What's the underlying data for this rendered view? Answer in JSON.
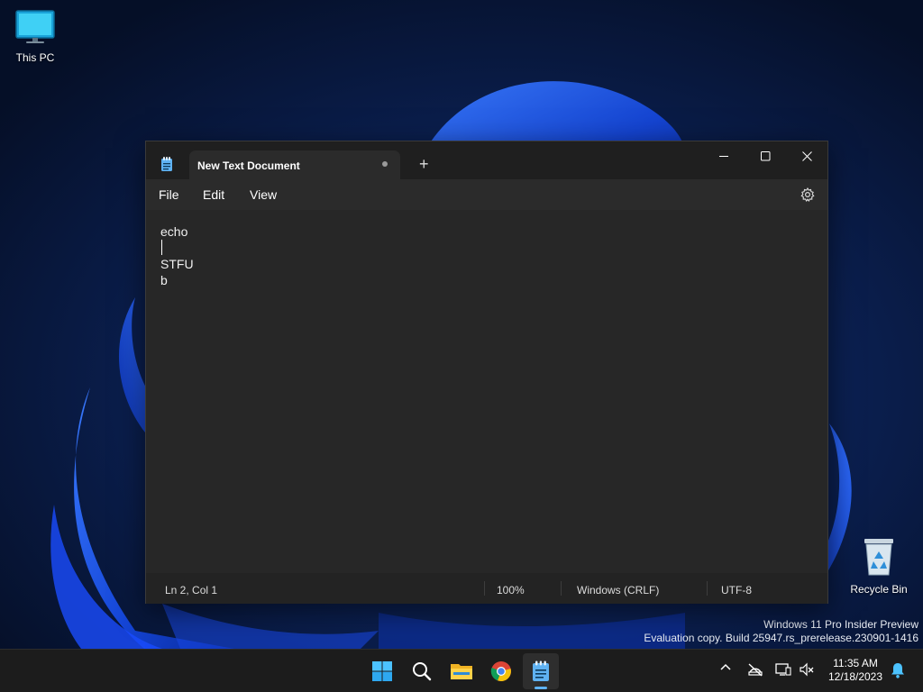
{
  "desktop": {
    "icons": [
      {
        "label": "This PC",
        "icon": "monitor-icon"
      },
      {
        "label": "Recycle Bin",
        "icon": "recycle-bin-icon"
      }
    ],
    "watermark": {
      "line1": "Windows 11 Pro Insider Preview",
      "line2": "Evaluation copy. Build 25947.rs_prerelease.230901-1416"
    }
  },
  "notepad": {
    "tab_title": "New Text Document",
    "unsaved_indicator": "dot",
    "new_tab_label": "+",
    "menu": [
      "File",
      "Edit",
      "View"
    ],
    "content": {
      "line1": "echo",
      "line2": "",
      "line3": "STFU",
      "line4": "b"
    },
    "status": {
      "position": "Ln 2, Col 1",
      "zoom": "100%",
      "line_ending": "Windows (CRLF)",
      "encoding": "UTF-8"
    }
  },
  "taskbar": {
    "apps": [
      "start-icon",
      "search-icon",
      "file-explorer-icon",
      "chrome-icon",
      "notepad-icon"
    ],
    "active_app": "notepad-icon",
    "clock": {
      "time": "11:35 AM",
      "date": "12/18/2023"
    }
  },
  "colors": {
    "wallpaper_bg": "#071633",
    "bloom_blue": "#1f5bff",
    "window_bg": "#272727",
    "titlebar_bg": "#1f1f1f",
    "accent": "#5fb2f2"
  }
}
